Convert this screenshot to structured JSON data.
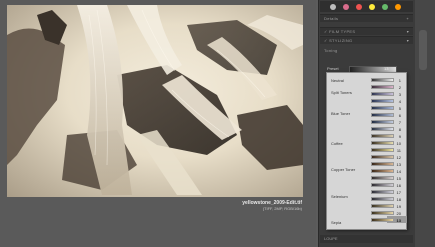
{
  "photo": {
    "title": "yellowstone_2009-Edit.tif",
    "meta": "(TIFF, 2MP, RGB/16b)"
  },
  "panel": {
    "swatch_colors": [
      "#bdbdbd",
      "#d96c8c",
      "#ef5350",
      "#ffeb3b",
      "#66bb6a",
      "#ff9800"
    ],
    "headers": {
      "details": "Details",
      "film_types": "FILM TYPES",
      "stylizing": "STYLIZING",
      "toning": "Toning",
      "loupe": "LOUPE"
    },
    "controls": {
      "preset": "Preset",
      "preset_value": "13",
      "strength": "Strength",
      "silver_hue": "Silver Hue",
      "silver_toning": "Silver Toning",
      "balance": "Balance",
      "paper_hue": "Paper Hue",
      "paper_toning": "Paper Toning",
      "vignette": "Vignette",
      "burn_edges": "Burn Edges"
    },
    "dropdown": {
      "categories": [
        "Neutral",
        "Split Toners",
        "Blue Toner",
        "Coffee",
        "Copper Toner",
        "Selenium",
        "Sepia"
      ],
      "numbers": [
        "1",
        "2",
        "3",
        "4",
        "5",
        "6",
        "7",
        "8",
        "9",
        "10",
        "11",
        "12",
        "13",
        "14",
        "15",
        "16",
        "17",
        "18",
        "19",
        "20"
      ],
      "selected": "13"
    }
  }
}
